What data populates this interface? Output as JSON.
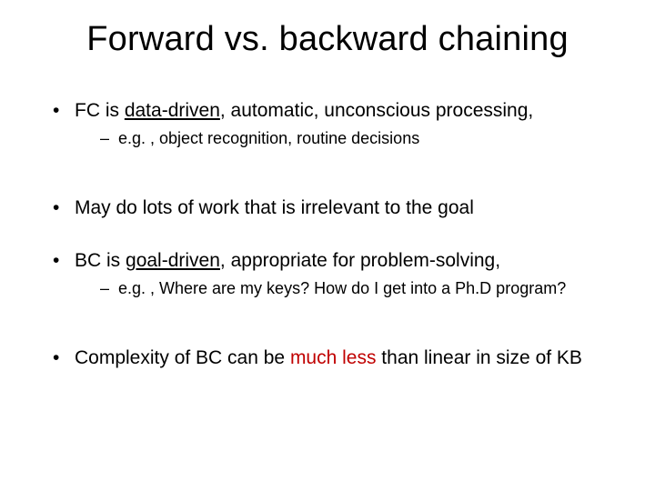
{
  "title": "Forward vs. backward chaining",
  "bullets": {
    "b1_pre": "FC is ",
    "b1_u": "data-driven",
    "b1_post": ", automatic, unconscious processing,",
    "b1_sub": "e.g. , object recognition, routine decisions",
    "b2": "May do lots of work that is irrelevant to the goal",
    "b3_pre": "BC is ",
    "b3_u": "goal-driven",
    "b3_post": ", appropriate for problem-solving,",
    "b3_sub": "e.g. , Where are my keys? How do I get into a Ph.D program?",
    "b4_pre": "Complexity of BC can be ",
    "b4_red": "much less",
    "b4_post": " than linear in size of KB"
  }
}
